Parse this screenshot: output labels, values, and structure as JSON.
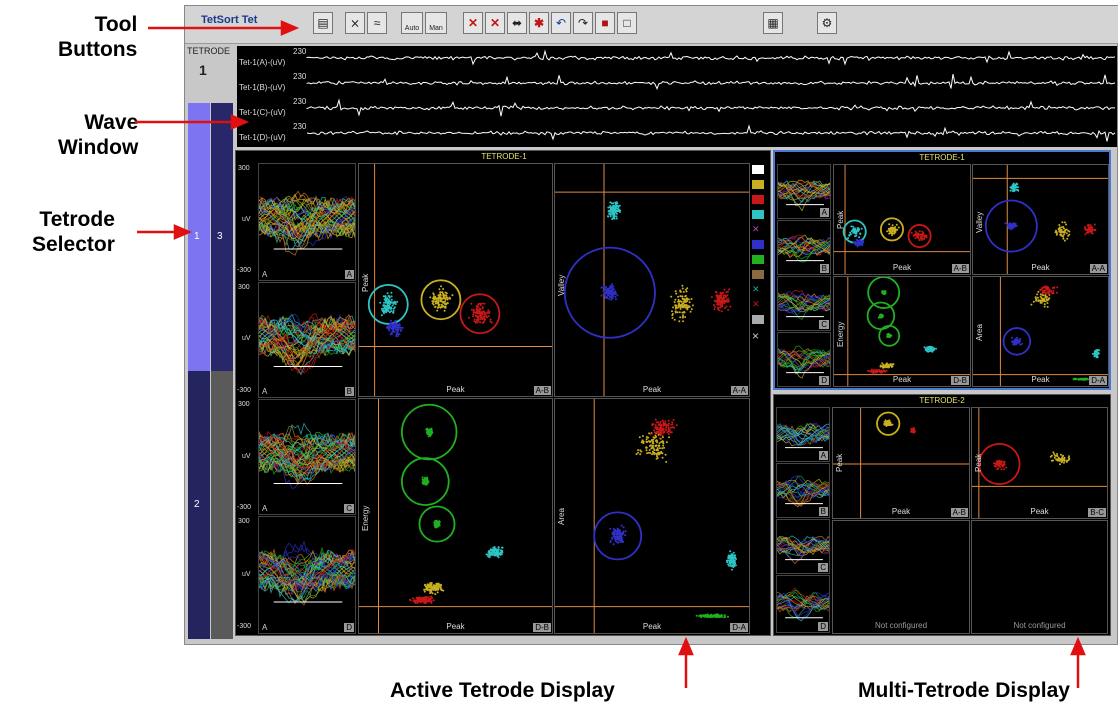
{
  "callouts": {
    "tool_buttons": "Tool\nButtons",
    "wave_window": "Wave\nWindow",
    "tetrode_selector": "Tetrode\nSelector",
    "active_display": "Active Tetrode Display",
    "multi_display": "Multi-Tetrode Display"
  },
  "app": {
    "title": "TetSort  Tet",
    "selector_header": "TETRODE",
    "selector_value": "1",
    "tetrodes": [
      "1",
      "3",
      "2"
    ]
  },
  "toolbar": {
    "auto_label": "Auto",
    "man_label": "Man"
  },
  "wave": {
    "channels": [
      "Tet-1(A)-(uV)",
      "Tet-1(B)-(uV)",
      "Tet-1(C)-(uV)",
      "Tet-1(D)-(uV)"
    ],
    "scale": "230"
  },
  "active": {
    "title": "TETRODE-1",
    "ytop": "300",
    "ybot": "-300",
    "uv": "uV",
    "channel_a": "A",
    "wave_cells": [
      "A",
      "B",
      "C",
      "D"
    ],
    "plots": {
      "ab": {
        "x": "Peak",
        "y": "Peak",
        "tag": "A-B"
      },
      "aa": {
        "x": "Peak",
        "y": "Valley",
        "tag": "A-A"
      },
      "db": {
        "x": "Peak",
        "y": "Energy",
        "tag": "D-B"
      },
      "da": {
        "x": "Peak",
        "y": "Area",
        "tag": "D-A"
      }
    }
  },
  "multi": {
    "t1": {
      "title": "TETRODE-1"
    },
    "t2": {
      "title": "TETRODE-2"
    },
    "not_configured": "Not configured",
    "t1plots": {
      "ab": {
        "x": "Peak",
        "y": "Peak",
        "tag": "A-B"
      },
      "aa": {
        "x": "Peak",
        "y": "Valley",
        "tag": "A-A"
      },
      "db": {
        "x": "Peak",
        "y": "Energy",
        "tag": "D-B"
      },
      "da": {
        "x": "Peak",
        "y": "Area",
        "tag": "D-A"
      }
    },
    "t2plots": {
      "ab": {
        "x": "Peak",
        "y": "Peak",
        "tag": "A-B"
      },
      "bc": {
        "x": "Peak",
        "y": "Peak",
        "tag": "B-C"
      }
    }
  },
  "colors": {
    "accent_callout": "#e01010",
    "cluster_cyan": "#2ec4c4",
    "cluster_yellow": "#c8b020",
    "cluster_red": "#c81818",
    "cluster_blue": "#3030c8",
    "cluster_green": "#20b020"
  }
}
